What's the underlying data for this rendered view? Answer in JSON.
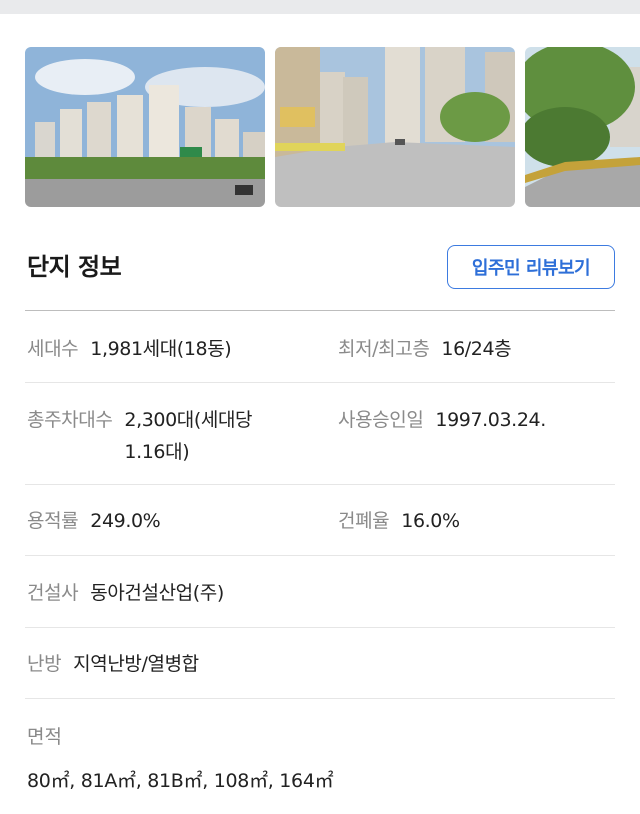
{
  "gallery": {
    "photos": [
      "apartment-complex-street-photo",
      "road-with-buildings-photo",
      "tree-lined-street-photo"
    ]
  },
  "section": {
    "title": "단지 정보",
    "review_button": "입주민 리뷰보기"
  },
  "info": {
    "households_label": "세대수",
    "households_value": "1,981세대(18동)",
    "floors_label": "최저/최고층",
    "floors_value": "16/24층",
    "parking_label": "총주차대수",
    "parking_value": "2,300대(세대당 1.16대)",
    "approval_label": "사용승인일",
    "approval_value": "1997.03.24.",
    "far_label": "용적률",
    "far_value": "249.0%",
    "bcr_label": "건폐율",
    "bcr_value": "16.0%",
    "builder_label": "건설사",
    "builder_value": "동아건설산업(주)",
    "heating_label": "난방",
    "heating_value": "지역난방/열병합",
    "area_label": "면적",
    "area_value": "80㎡, 81A㎡, 81B㎡, 108㎡, 164㎡"
  }
}
